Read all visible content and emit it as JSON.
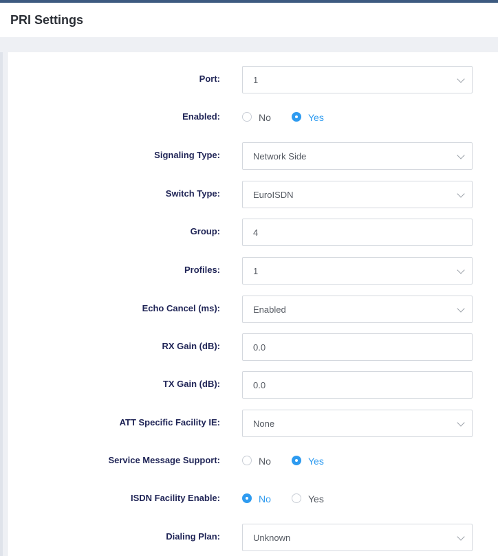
{
  "page": {
    "title": "PRI Settings"
  },
  "form": {
    "port": {
      "label": "Port:",
      "value": "1"
    },
    "enabled": {
      "label": "Enabled:",
      "options": [
        "No",
        "Yes"
      ],
      "selected": "Yes"
    },
    "signaling_type": {
      "label": "Signaling Type:",
      "value": "Network Side"
    },
    "switch_type": {
      "label": "Switch Type:",
      "value": "EuroISDN"
    },
    "group": {
      "label": "Group:",
      "value": "4"
    },
    "profiles": {
      "label": "Profiles:",
      "value": "1"
    },
    "echo_cancel": {
      "label": "Echo Cancel (ms):",
      "value": "Enabled"
    },
    "rx_gain": {
      "label": "RX Gain (dB):",
      "value": "0.0"
    },
    "tx_gain": {
      "label": "TX Gain (dB):",
      "value": "0.0"
    },
    "att_facility_ie": {
      "label": "ATT Specific Facility IE:",
      "value": "None"
    },
    "service_message_support": {
      "label": "Service Message Support:",
      "options": [
        "No",
        "Yes"
      ],
      "selected": "Yes"
    },
    "isdn_facility_enable": {
      "label": "ISDN Facility Enable:",
      "options": [
        "No",
        "Yes"
      ],
      "selected": "No"
    },
    "dialing_plan": {
      "label": "Dialing Plan:",
      "value": "Unknown"
    }
  },
  "colors": {
    "accent": "#2e9bf0",
    "label_text": "#1f2456",
    "top_bar": "#3d5a80"
  },
  "icons": {
    "dropdown": "chevron-down-icon"
  }
}
